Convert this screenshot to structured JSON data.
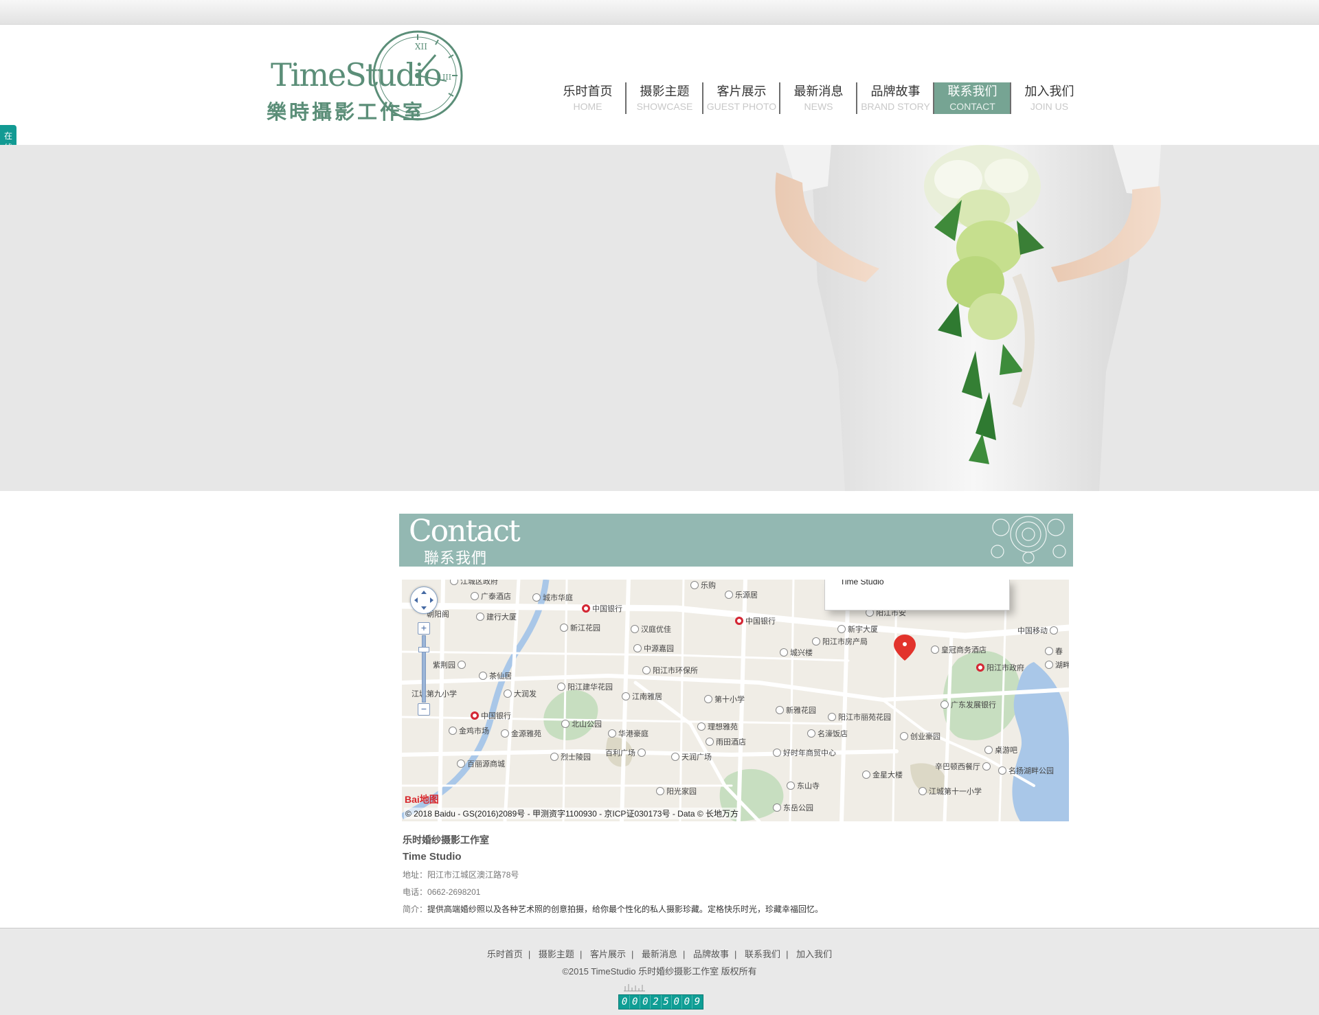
{
  "brand": {
    "name_en": "TimeStudio",
    "name_cn": "樂時攝影工作室",
    "accent": "#5b8e78"
  },
  "nav": {
    "items": [
      {
        "cn": "乐时首页",
        "en": "HOME"
      },
      {
        "cn": "摄影主题",
        "en": "SHOWCASE"
      },
      {
        "cn": "客片展示",
        "en": "GUEST PHOTO"
      },
      {
        "cn": "最新消息",
        "en": "NEWS"
      },
      {
        "cn": "品牌故事",
        "en": "BRAND STORY"
      },
      {
        "cn": "联系我们",
        "en": "CONTACT"
      },
      {
        "cn": "加入我们",
        "en": "JOIN US"
      }
    ],
    "active_index": 5,
    "active_color": "#76a493"
  },
  "side_tab": {
    "label": "在线客服",
    "icon": "arrow-right-icon",
    "color": "#129a93"
  },
  "contact_header": {
    "en": "Contact",
    "cn": "聯系我們",
    "color": "#93b8b2"
  },
  "map": {
    "info_window_title": "Time Studio",
    "baidu_logo": "Bai地图",
    "copyright": "© 2018 Baidu - GS(2016)2089号 - 甲测资字1100930 - 京ICP证030173号 - Data © 长地万方",
    "labels": {
      "l01": "江城区政府",
      "l02": "乐购",
      "l03": "广泰酒店",
      "l04": "城市华庭",
      "l05": "乐源居",
      "l06": "中国银行",
      "l07": "中国银行",
      "l08": "阳江市安",
      "l09": "朝阳阁",
      "l10": "建行大厦",
      "l11": "新江花园",
      "l12": "汉庭优佳",
      "l13": "新宇大厦",
      "l14": "中国移动",
      "l15": "阳江市房产局",
      "l16": "中源嘉园",
      "l17": "城兴楼",
      "l18": "皇冠商务酒店",
      "l19": "春",
      "l20": "紫荆园",
      "l21": "茶仙居",
      "l22": "阳江市环保所",
      "l23": "湖畔",
      "l24": "阳江市政府",
      "l25": "江城第九小学",
      "l26": "大润发",
      "l27": "阳江建华花园",
      "l28": "江南雅居",
      "l29": "第十小学",
      "l30": "广东发展银行",
      "l31": "中国银行",
      "l32": "新雅花园",
      "l33": "阳江市丽苑花园",
      "l34": "金鸡市场",
      "l35": "金源雅苑",
      "l36": "北山公园",
      "l37": "华港豪庭",
      "l38": "理想雅苑",
      "l39": "名濠饭店",
      "l40": "创业豪园",
      "l41": "桌游吧",
      "l42": "雨田酒店",
      "l43": "好时年商贸中心",
      "l44": "百利广场",
      "l45": "天润广场",
      "l46": "烈士陵园",
      "l47": "百丽源商城",
      "l48": "辛巴顿西餐厅",
      "l49": "名扬湖畔公园",
      "l50": "金星大楼",
      "l51": "东山寺",
      "l52": "阳光家园",
      "l53": "江城第十一小学",
      "l54": "东岳公园",
      "l55": "东岳公园"
    }
  },
  "info": {
    "name_cn": "乐时婚纱摄影工作室",
    "name_en": "Time Studio",
    "address_label": "地址：",
    "address": "阳江市江城区澳江路78号",
    "phone_label": "电话：",
    "phone": "0662-2698201",
    "intro_label": "简介：",
    "intro": "提供高端婚纱照以及各种艺术照的创意拍摄，给你最个性化的私人摄影珍藏。定格快乐时光，珍藏幸福回忆。"
  },
  "footer": {
    "links": [
      "乐时首页",
      "摄影主题",
      "客片展示",
      "最新消息",
      "品牌故事",
      "联系我们",
      "加入我们"
    ],
    "separator": "|",
    "copyright": "©2015 TimeStudio 乐时婚纱摄影工作室 版权所有",
    "counter_digits": [
      "0",
      "0",
      "0",
      "2",
      "5",
      "0",
      "0",
      "9"
    ],
    "counter_color": "#0f9e95"
  }
}
